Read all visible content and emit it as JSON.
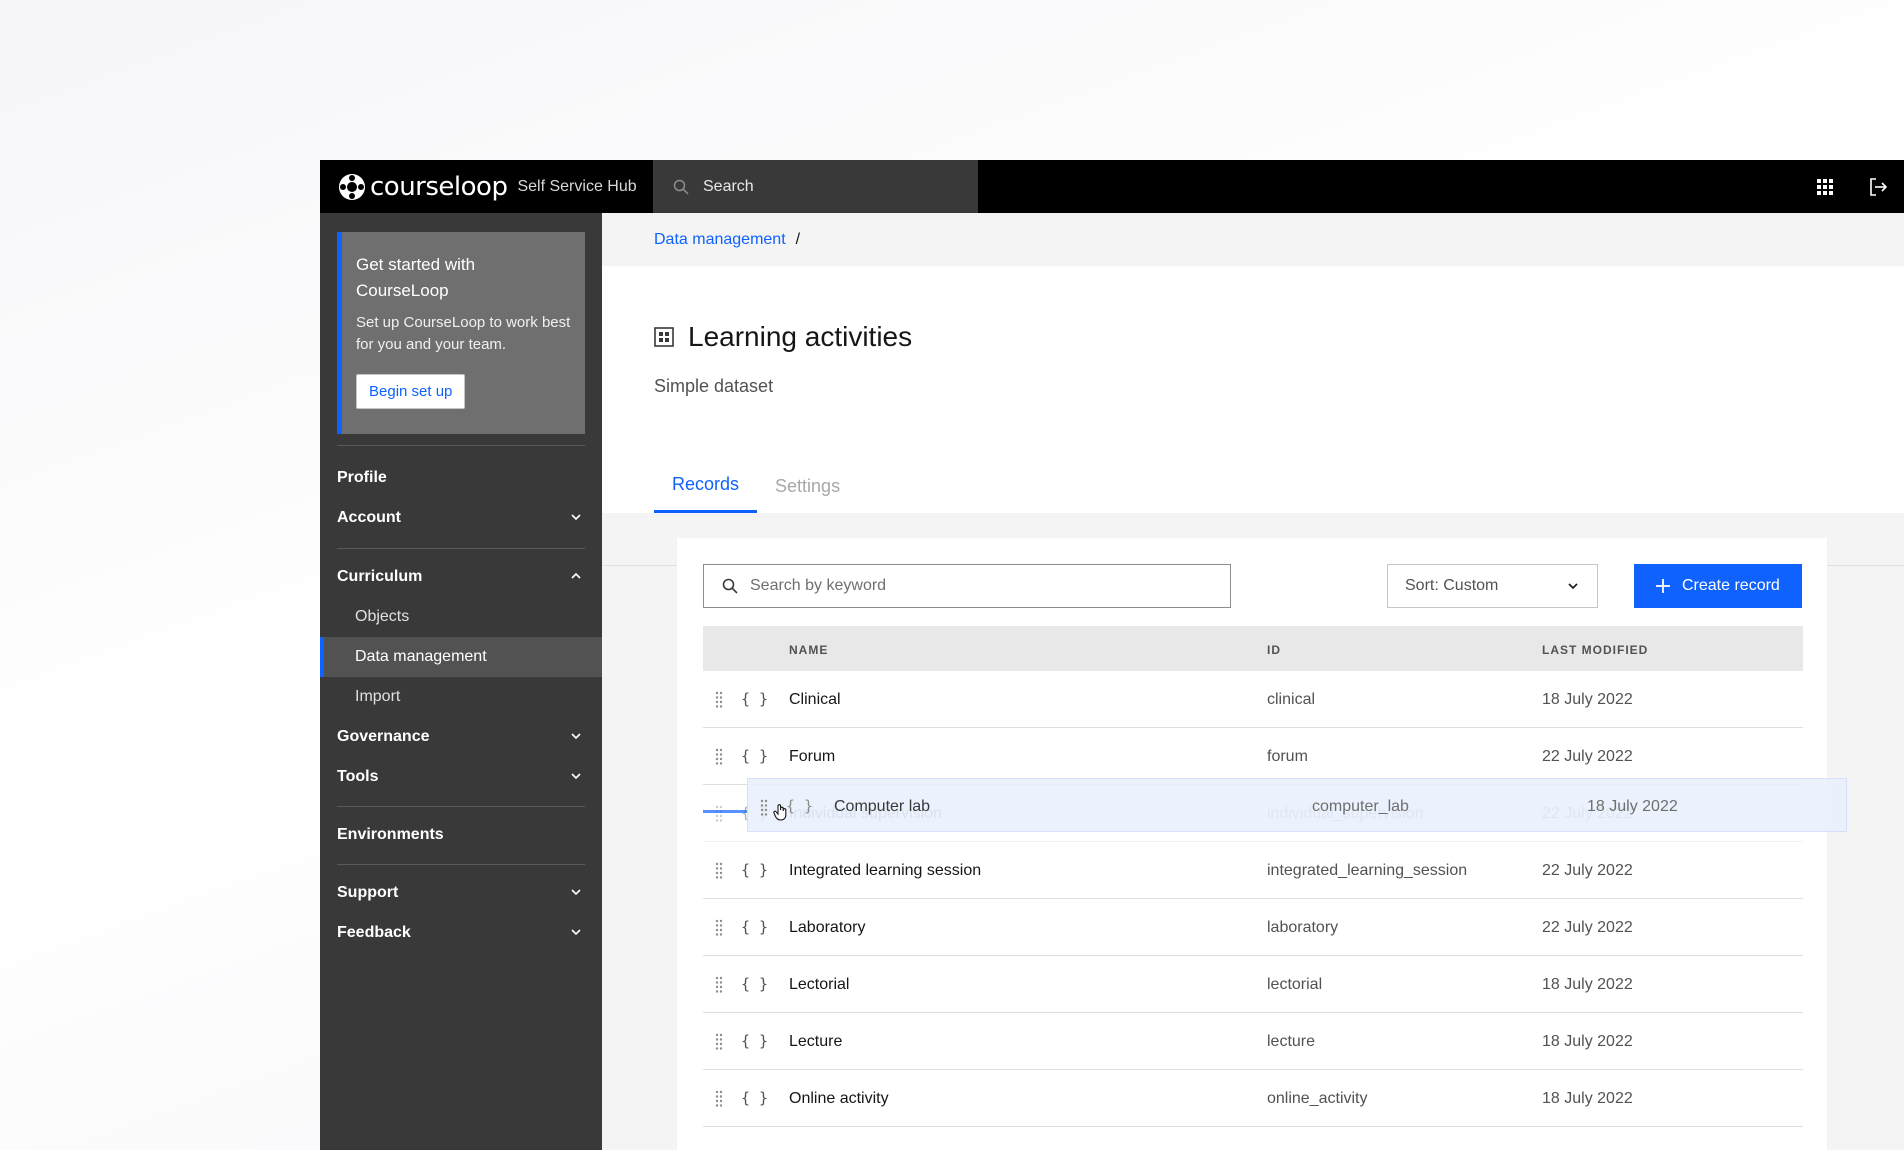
{
  "brand": {
    "logo_text": "courseloop",
    "hub_name": "Self Service Hub"
  },
  "topbar": {
    "search_placeholder": "Search",
    "apps_icon": "grid-icon",
    "logout_icon": "logout-icon"
  },
  "sidebar": {
    "promo": {
      "title": "Get started with CourseLoop",
      "text": "Set up CourseLoop to work best for you and your team.",
      "button": "Begin set up"
    },
    "items": [
      {
        "label": "Profile"
      },
      {
        "label": "Account"
      },
      {
        "label": "Curriculum"
      },
      {
        "label": "Objects"
      },
      {
        "label": "Data management"
      },
      {
        "label": "Import"
      },
      {
        "label": "Governance"
      },
      {
        "label": "Tools"
      },
      {
        "label": "Environments"
      },
      {
        "label": "Support"
      },
      {
        "label": "Feedback"
      }
    ]
  },
  "breadcrumb": {
    "link": "Data management",
    "separator": "/"
  },
  "page": {
    "title": "Learning activities",
    "subtitle": "Simple dataset",
    "tabs": [
      {
        "label": "Records"
      },
      {
        "label": "Settings"
      }
    ]
  },
  "toolbar": {
    "search_placeholder": "Search by keyword",
    "sort_label": "Sort: Custom",
    "create_label": "Create record"
  },
  "table": {
    "headers": {
      "name": "NAME",
      "id": "ID",
      "modified": "LAST MODIFIED"
    },
    "rows": [
      {
        "name": "Clinical",
        "id": "clinical",
        "modified": "18 July 2022"
      },
      {
        "name": "Forum",
        "id": "forum",
        "modified": "22 July 2022"
      },
      {
        "name": "Individual supervision",
        "id": "individual_supervision",
        "modified": "22 July 2022"
      },
      {
        "name": "Integrated learning session",
        "id": "integrated_learning_session",
        "modified": "22 July 2022"
      },
      {
        "name": "Laboratory",
        "id": "laboratory",
        "modified": "22 July 2022"
      },
      {
        "name": "Lectorial",
        "id": "lectorial",
        "modified": "18 July 2022"
      },
      {
        "name": "Lecture",
        "id": "lecture",
        "modified": "18 July 2022"
      },
      {
        "name": "Online activity",
        "id": "online_activity",
        "modified": "18 July 2022"
      }
    ],
    "dragging": {
      "name": "Computer lab",
      "id": "computer_lab",
      "modified": "18 July 2022"
    },
    "row_icon_text": "{ }"
  },
  "colors": {
    "accent": "#0f62fe",
    "sidebar_bg": "#393939",
    "topbar_bg": "#000000"
  }
}
